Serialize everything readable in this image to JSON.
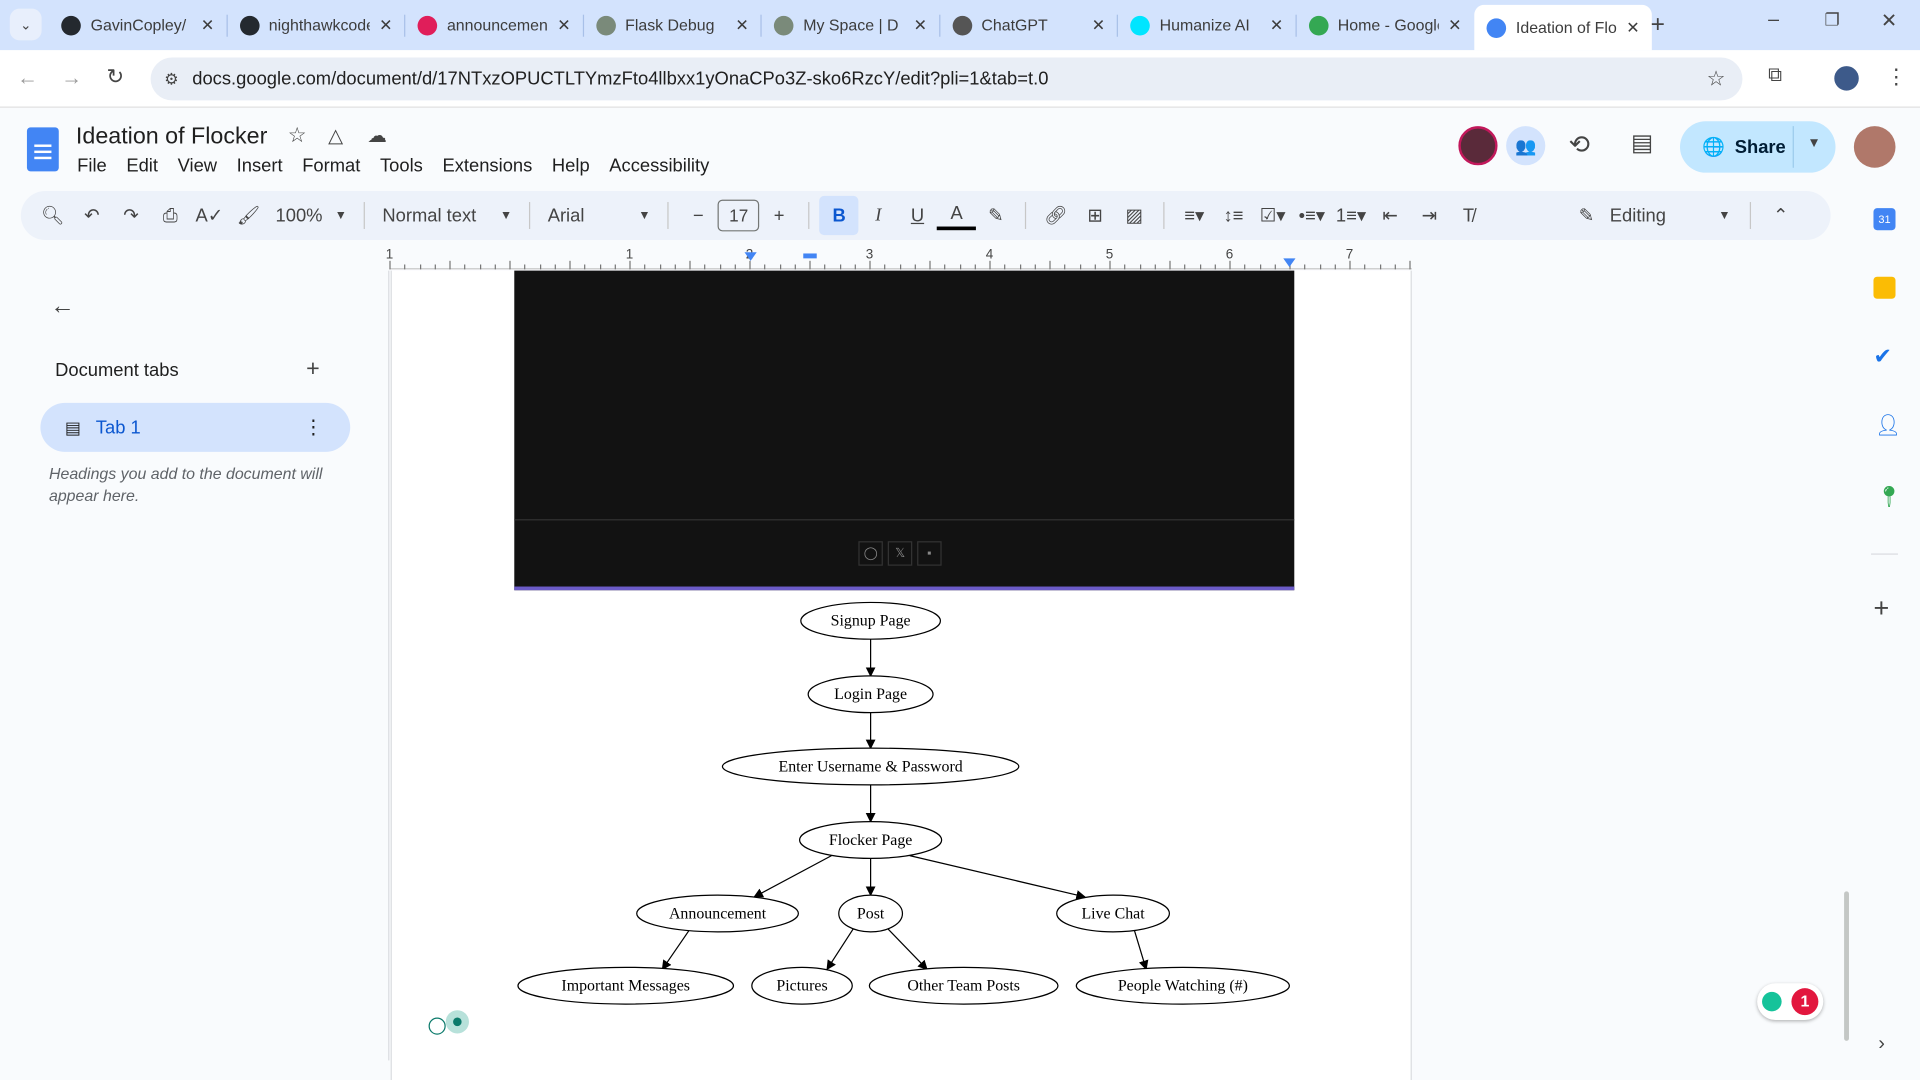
{
  "browser": {
    "tabs": [
      {
        "title": "GavinCopley/",
        "icon": "github-icon"
      },
      {
        "title": "nighthawkcoders",
        "icon": "github-icon"
      },
      {
        "title": "announcements",
        "icon": "slack-icon"
      },
      {
        "title": "Flask Debug",
        "icon": "flask-icon"
      },
      {
        "title": "My Space | D",
        "icon": "flask-icon"
      },
      {
        "title": "ChatGPT",
        "icon": "chatgpt-icon"
      },
      {
        "title": "Humanize AI",
        "icon": "humanize-icon"
      },
      {
        "title": "Home - Google Drive",
        "icon": "drive-icon"
      },
      {
        "title": "Ideation of Flocker",
        "icon": "docs-icon",
        "active": true
      }
    ],
    "url": "docs.google.com/document/d/17NTxzOPUCTLTYmzFto4llbxx1yOnaCPo3Z-sko6RzcY/edit?pli=1&tab=t.0"
  },
  "doc": {
    "title": "Ideation of Flocker",
    "menu": [
      "File",
      "Edit",
      "View",
      "Insert",
      "Format",
      "Tools",
      "Extensions",
      "Help",
      "Accessibility"
    ],
    "share_label": "Share"
  },
  "toolbar": {
    "zoom": "100%",
    "style": "Normal text",
    "font": "Arial",
    "font_size": "17",
    "mode": "Editing"
  },
  "ruler": {
    "labels": [
      "1",
      "1",
      "2",
      "3",
      "4",
      "5",
      "6",
      "7"
    ]
  },
  "sidebar": {
    "heading": "Document tabs",
    "tab_label": "Tab 1",
    "hint": "Headings you add to the document will appear here."
  },
  "diagram": {
    "nodes": [
      "Signup Page",
      "Login Page",
      "Enter Username & Password",
      "Flocker Page",
      "Announcement",
      "Post",
      "Live Chat",
      "Important Messages",
      "Pictures",
      "Other Team Posts",
      "People Watching (#)"
    ]
  },
  "embedded_footer_icons": [
    "github-icon",
    "x-icon",
    "youtube-icon"
  ],
  "notification_count": "1",
  "colors": {
    "accent": "#0b57d0",
    "share_bg": "#c2e7ff",
    "tab_strip": "#d3e3fd",
    "embed_bg": "#121212",
    "embed_border": "#6b5bc7"
  }
}
